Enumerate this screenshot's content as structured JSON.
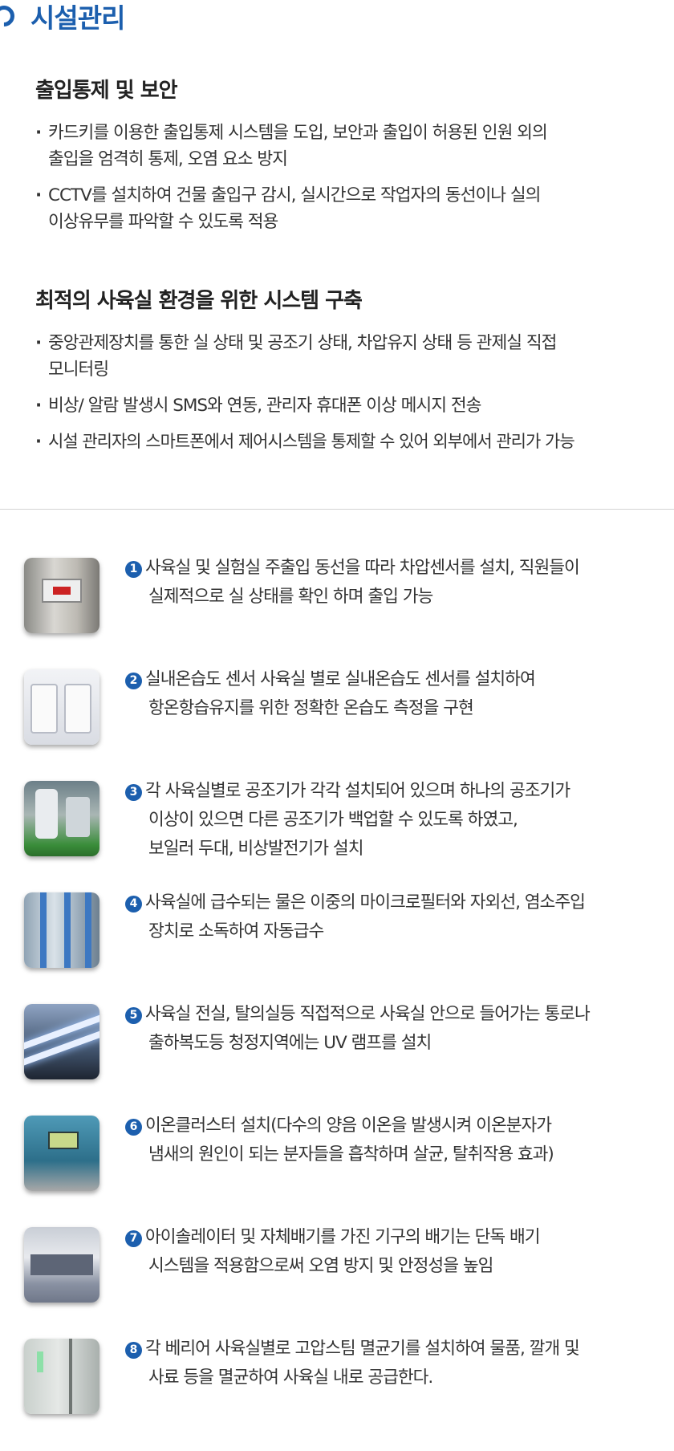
{
  "header": {
    "title": "시설관리"
  },
  "sections": [
    {
      "heading": "출입통제 및 보안",
      "bullets": [
        [
          "카드키를 이용한 출입통제 시스템을 도입, 보안과 출입이 허용된 인원 외의",
          "출입을 엄격히 통제, 오염 요소 방지"
        ],
        [
          "CCTV를 설치하여 건물 출입구 감시, 실시간으로 작업자의 동선이나 실의",
          "이상유무를 파악할 수 있도록 적용"
        ]
      ]
    },
    {
      "heading": "최적의 사육실 환경을 위한 시스템 구축",
      "bullets": [
        [
          "중앙관제장치를 통한 실 상태 및 공조기 상태, 차압유지 상태 등 관제실 직접",
          "모니터링"
        ],
        [
          "비상/ 알람 발생시 SMS와 연동, 관리자 휴대폰 이상 메시지 전송"
        ],
        [
          "시설 관리자의 스마트폰에서 제어시스템을 통제할 수 있어 외부에서 관리가 가능"
        ]
      ]
    }
  ],
  "features": [
    {
      "num": "1",
      "lines": [
        "사육실 및 실험실 주출입 동선을 따라 차압센서를 설치, 직원들이",
        "실제적으로 실 상태를 확인 하며 출입 가능"
      ]
    },
    {
      "num": "2",
      "lines": [
        "실내온습도 센서 사육실 별로 실내온습도 센서를 설치하여",
        "항온항습유지를 위한 정확한 온습도 측정을 구현"
      ]
    },
    {
      "num": "3",
      "lines": [
        "각 사육실별로 공조기가 각각 설치되어 있으며 하나의 공조기가",
        "이상이 있으면 다른 공조기가 백업할 수 있도록 하였고,",
        "보일러 두대, 비상발전기가 설치"
      ]
    },
    {
      "num": "4",
      "lines": [
        "사육실에 급수되는 물은 이중의 마이크로필터와 자외선, 염소주입",
        "장치로 소독하여 자동급수"
      ]
    },
    {
      "num": "5",
      "lines": [
        "사육실 전실, 탈의실등 직접적으로 사육실 안으로 들어가는 통로나",
        "출하복도등 청정지역에는 UV 램프를 설치"
      ]
    },
    {
      "num": "6",
      "lines": [
        "이온클러스터 설치(다수의 양음 이온을 발생시켜 이온분자가",
        "냄새의 원인이 되는 분자들을 흡착하며 살균, 탈취작용 효과)"
      ]
    },
    {
      "num": "7",
      "lines": [
        "아이솔레이터 및 자체배기를 가진 기구의 배기는 단독 배기",
        "시스템을 적용함으로써 오염 방지 및 안정성을 높임"
      ]
    },
    {
      "num": "8",
      "lines": [
        "각 베리어 사육실별로 고압스팀 멸균기를 설치하여 물품, 깔개 및",
        "사료 등을 멸균하여 사육실 내로 공급한다."
      ]
    }
  ],
  "colors": {
    "accent": "#1c5fae",
    "text": "#333333",
    "divider": "#d4d4d4"
  }
}
